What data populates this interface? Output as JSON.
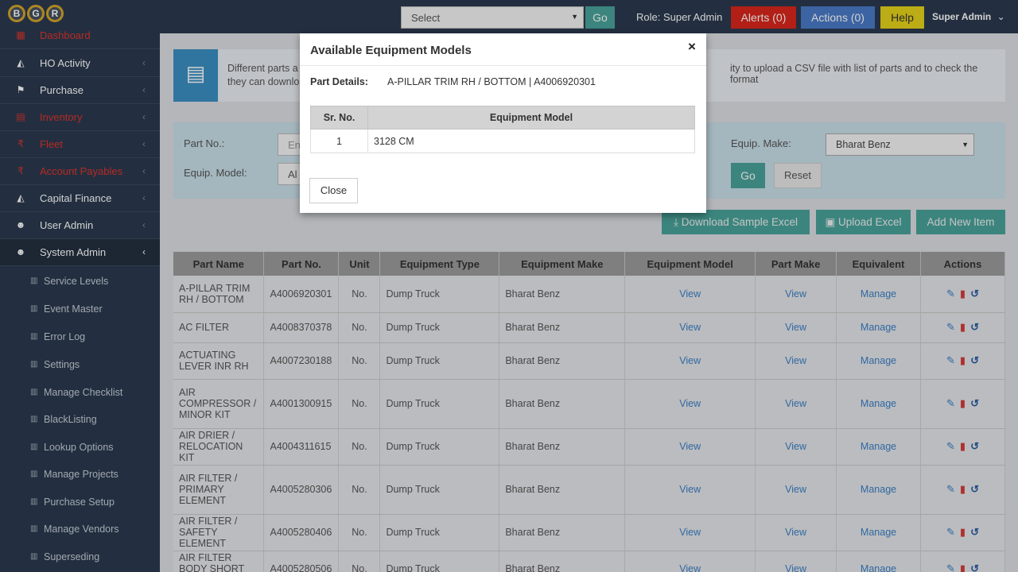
{
  "header": {
    "logo_letters": [
      "B",
      "G",
      "R"
    ],
    "select_placeholder": "Select",
    "go_label": "Go",
    "role_text": "Role: Super Admin",
    "alerts_label": "Alerts (0)",
    "actions_label": "Actions (0)",
    "help_label": "Help",
    "user_label": "Super Admin"
  },
  "sidebar": {
    "items": [
      {
        "label": "Dashboard",
        "icon": "dashboard-icon",
        "color": "red"
      },
      {
        "label": "HO Activity",
        "icon": "chart-icon"
      },
      {
        "label": "Purchase",
        "icon": "flag-icon"
      },
      {
        "label": "Inventory",
        "icon": "table-icon",
        "color": "red"
      },
      {
        "label": "Fleet",
        "icon": "rupee-icon",
        "color": "red"
      },
      {
        "label": "Account Payables",
        "icon": "rupee-icon",
        "color": "red"
      },
      {
        "label": "Capital Finance",
        "icon": "chart-icon"
      },
      {
        "label": "User Admin",
        "icon": "users-icon"
      },
      {
        "label": "System Admin",
        "icon": "users-icon",
        "active": true
      }
    ],
    "subitems": [
      "Service Levels",
      "Event Master",
      "Error Log",
      "Settings",
      "Manage Checklist",
      "BlackListing",
      "Lookup Options",
      "Manage Projects",
      "Purchase Setup",
      "Manage Vendors",
      "Superseding"
    ]
  },
  "info": {
    "line1_start": "Different parts a",
    "line1_end": "ity to upload a CSV file with list of parts and to check the format",
    "line2": "they can downlo"
  },
  "filter": {
    "part_no_label": "Part No.:",
    "part_no_placeholder": "En",
    "equip_model_label": "Equip. Model:",
    "equip_model_value": "Al",
    "equip_make_label": "Equip. Make:",
    "equip_make_value": "Bharat Benz",
    "go_label": "Go",
    "reset_label": "Reset"
  },
  "actions": {
    "download_label": "Download Sample Excel",
    "upload_label": "Upload Excel",
    "add_label": "Add New Item"
  },
  "table": {
    "headers": [
      "Part Name",
      "Part No.",
      "Unit",
      "Equipment Type",
      "Equipment Make",
      "Equipment Model",
      "Part Make",
      "Equivalent",
      "Actions"
    ],
    "rows": [
      {
        "name": "A-PILLAR TRIM RH / BOTTOM",
        "no": "A4006920301",
        "unit": "No.",
        "type": "Dump Truck",
        "make": "Bharat Benz",
        "model": "View",
        "part_make": "View",
        "equivalent": "Manage"
      },
      {
        "name": "AC FILTER",
        "no": "A4008370378",
        "unit": "No.",
        "type": "Dump Truck",
        "make": "Bharat Benz",
        "model": "View",
        "part_make": "View",
        "equivalent": "Manage"
      },
      {
        "name": "ACTUATING LEVER INR RH",
        "no": "A4007230188",
        "unit": "No.",
        "type": "Dump Truck",
        "make": "Bharat Benz",
        "model": "View",
        "part_make": "View",
        "equivalent": "Manage"
      },
      {
        "name": "AIR COMPRESSOR / MINOR KIT",
        "no": "A4001300915",
        "unit": "No.",
        "type": "Dump Truck",
        "make": "Bharat Benz",
        "model": "View",
        "part_make": "View",
        "equivalent": "Manage"
      },
      {
        "name": "AIR DRIER / RELOCATION KIT",
        "no": "A4004311615",
        "unit": "No.",
        "type": "Dump Truck",
        "make": "Bharat Benz",
        "model": "View",
        "part_make": "View",
        "equivalent": "Manage"
      },
      {
        "name": "AIR FILTER / PRIMARY ELEMENT",
        "no": "A4005280306",
        "unit": "No.",
        "type": "Dump Truck",
        "make": "Bharat Benz",
        "model": "View",
        "part_make": "View",
        "equivalent": "Manage"
      },
      {
        "name": "AIR FILTER / SAFETY ELEMENT",
        "no": "A4005280406",
        "unit": "No.",
        "type": "Dump Truck",
        "make": "Bharat Benz",
        "model": "View",
        "part_make": "View",
        "equivalent": "Manage"
      },
      {
        "name": "AIR FILTER BODY SHORT CABIN",
        "no": "A4005280506",
        "unit": "No.",
        "type": "Dump Truck",
        "make": "Bharat Benz",
        "model": "View",
        "part_make": "View",
        "equivalent": "Manage"
      }
    ]
  },
  "modal": {
    "title": "Available Equipment Models",
    "close_icon": "×",
    "part_details_label": "Part Details:",
    "part_details_value": "A-PILLAR TRIM RH / BOTTOM | A4006920301",
    "headers": [
      "Sr. No.",
      "Equipment Model"
    ],
    "rows": [
      {
        "sr": "1",
        "model": "3128 CM"
      }
    ],
    "close_label": "Close"
  }
}
